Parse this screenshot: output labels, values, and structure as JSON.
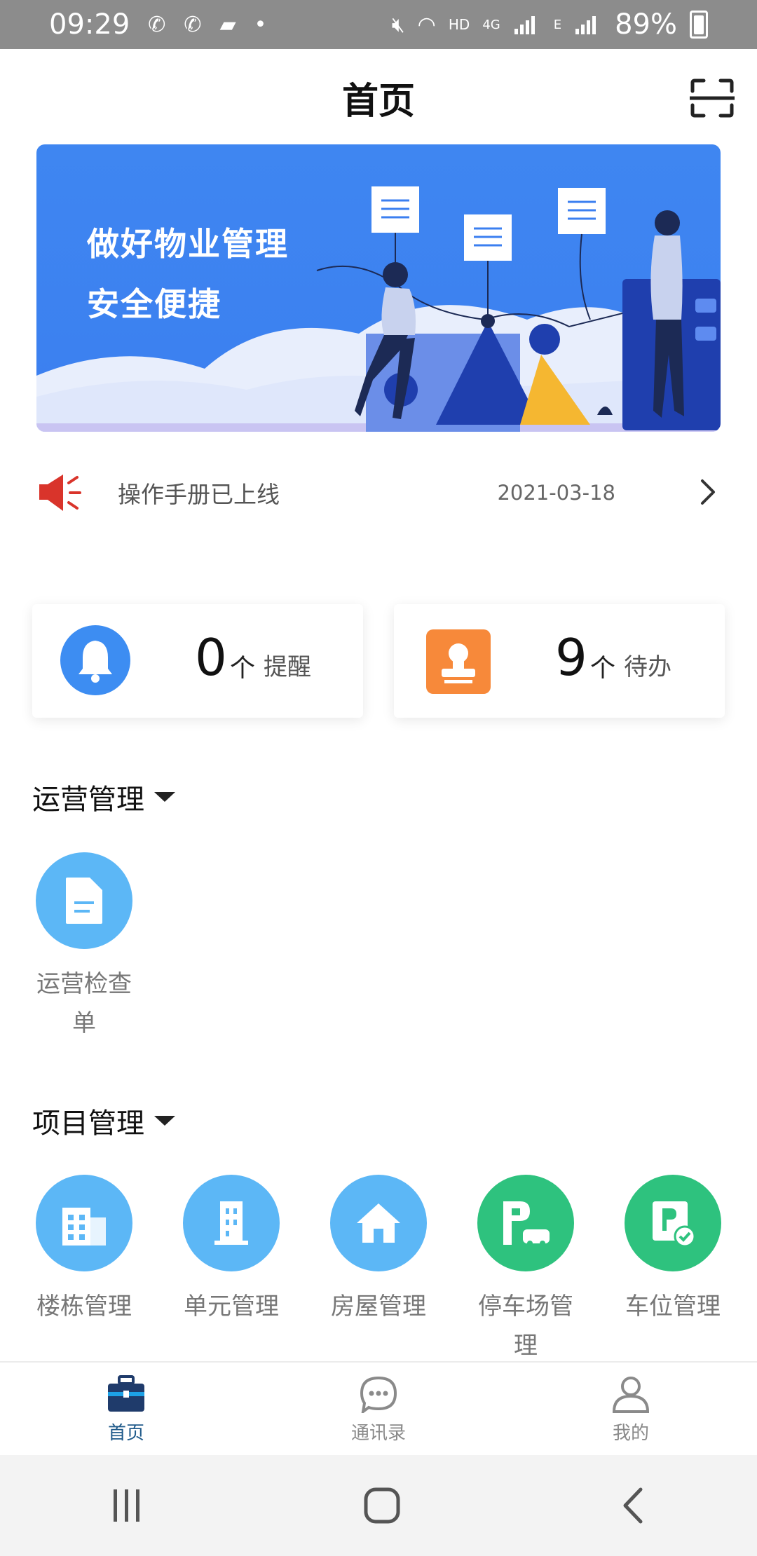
{
  "status_bar": {
    "time": "09:29",
    "network": "HD",
    "lte": "4G",
    "lte2": "E",
    "battery": "89%"
  },
  "header": {
    "title": "首页",
    "scan_icon": "scan-icon"
  },
  "banner": {
    "line1": "做好物业管理",
    "line2": "安全便捷"
  },
  "notice": {
    "icon": "megaphone-icon",
    "text": "操作手册已上线",
    "date": "2021-03-18"
  },
  "cards": {
    "reminders": {
      "count": "0",
      "unit": "个",
      "label": "提醒",
      "icon": "bell-icon"
    },
    "todos": {
      "count": "9",
      "unit": "个",
      "label": "待办",
      "icon": "stamp-icon"
    }
  },
  "sections": {
    "operations": {
      "title": "运营管理",
      "items": [
        {
          "label_line1": "运营检查",
          "label_line2": "单",
          "icon": "document-icon"
        }
      ]
    },
    "projects": {
      "title": "项目管理",
      "items": [
        {
          "label_line1": "楼栋管理",
          "label_line2": "",
          "icon": "buildings-icon"
        },
        {
          "label_line1": "单元管理",
          "label_line2": "",
          "icon": "building-unit-icon"
        },
        {
          "label_line1": "房屋管理",
          "label_line2": "",
          "icon": "house-icon"
        },
        {
          "label_line1": "停车场管",
          "label_line2": "理",
          "icon": "parking-lot-icon"
        },
        {
          "label_line1": "车位管理",
          "label_line2": "",
          "icon": "parking-space-icon"
        }
      ]
    }
  },
  "bottom_nav": {
    "items": [
      {
        "label": "首页",
        "icon": "briefcase-icon",
        "active": true
      },
      {
        "label": "通讯录",
        "icon": "chat-bubble-icon",
        "active": false
      },
      {
        "label": "我的",
        "icon": "user-icon",
        "active": false
      }
    ]
  },
  "colors": {
    "banner_blue": "#3f86f1",
    "icon_blue": "#5cb7f6",
    "icon_green": "#2ec27e",
    "active_nav": "#1f5a8a",
    "megaphone_red": "#d9342b"
  }
}
